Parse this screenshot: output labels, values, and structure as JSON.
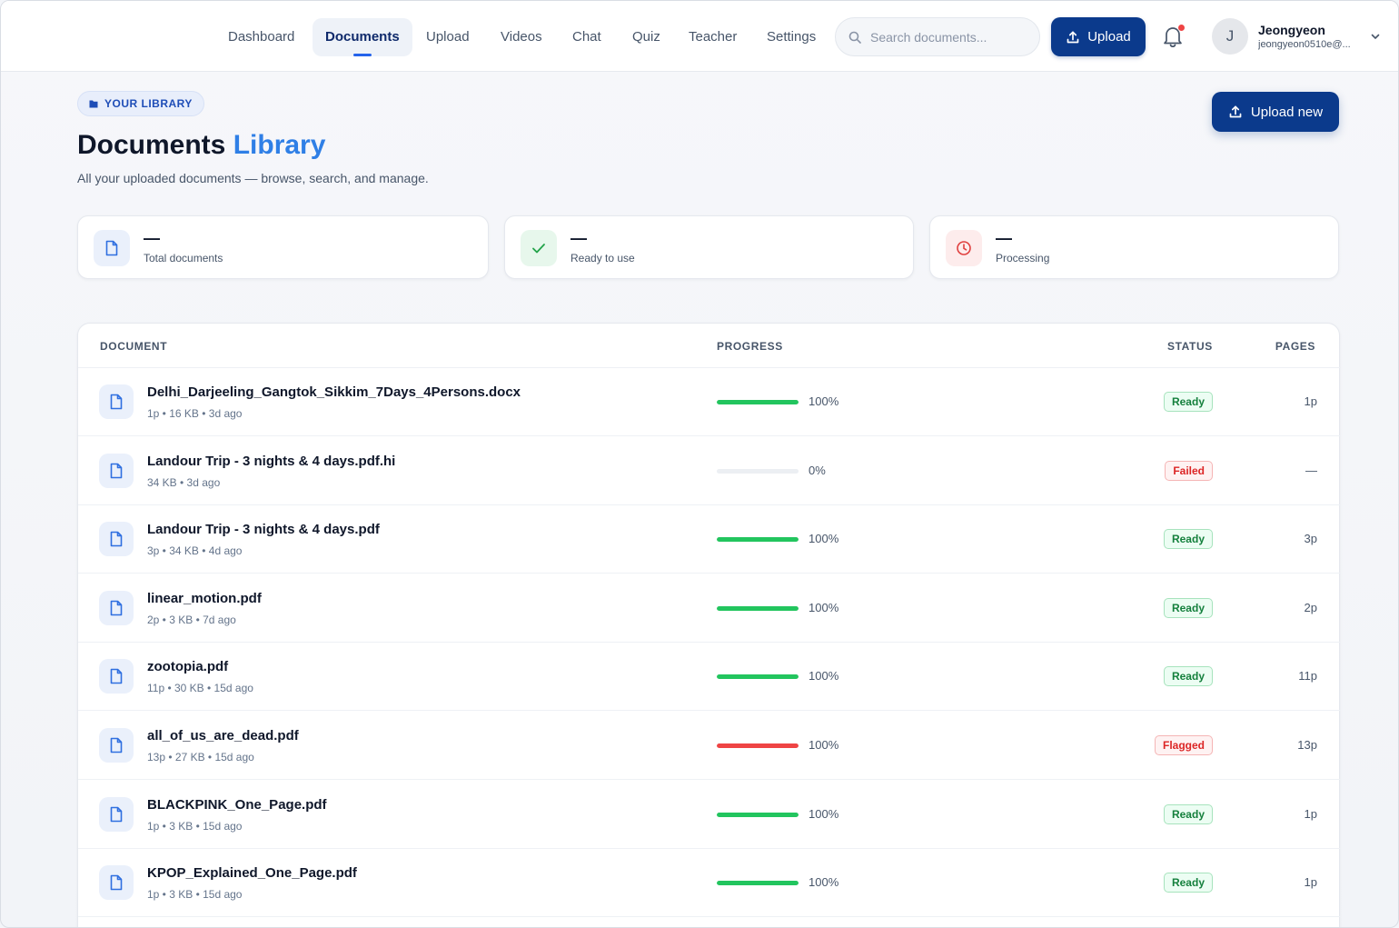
{
  "nav": {
    "items": [
      {
        "label": "Dashboard",
        "active": false
      },
      {
        "label": "Documents",
        "active": true
      },
      {
        "label": "Upload",
        "active": false
      },
      {
        "label": "Videos",
        "active": false
      },
      {
        "label": "Chat",
        "active": false
      },
      {
        "label": "Quiz",
        "active": false
      },
      {
        "label": "Teacher",
        "active": false
      },
      {
        "label": "Settings",
        "active": false
      }
    ],
    "search_placeholder": "Search documents...",
    "upload_label": "Upload",
    "user": {
      "initial": "J",
      "name": "Jeongyeon",
      "email": "jeongyeon0510e@..."
    }
  },
  "header": {
    "badge": "YOUR LIBRARY",
    "title_main": "Documents",
    "title_accent": "Library",
    "subtitle": "All your uploaded documents — browse, search, and manage.",
    "upload_new_label": "Upload new"
  },
  "stats": [
    {
      "value": "—",
      "label": "Total documents"
    },
    {
      "value": "—",
      "label": "Ready to use"
    },
    {
      "value": "—",
      "label": "Processing"
    }
  ],
  "table": {
    "headers": {
      "document": "DOCUMENT",
      "progress": "PROGRESS",
      "status": "STATUS",
      "pages": "PAGES"
    },
    "rows": [
      {
        "name": "Delhi_Darjeeling_Gangtok_Sikkim_7Days_4Persons.docx",
        "meta": "1p • 16 KB • 3d ago",
        "progress": 100,
        "progress_label": "100%",
        "status": "Ready",
        "pages": "1p"
      },
      {
        "name": "Landour Trip - 3 nights & 4 days.pdf.hi",
        "meta": "34 KB • 3d ago",
        "progress": 0,
        "progress_label": "0%",
        "status": "Failed",
        "pages": "—"
      },
      {
        "name": "Landour Trip - 3 nights & 4 days.pdf",
        "meta": "3p • 34 KB • 4d ago",
        "progress": 100,
        "progress_label": "100%",
        "status": "Ready",
        "pages": "3p"
      },
      {
        "name": "linear_motion.pdf",
        "meta": "2p • 3 KB • 7d ago",
        "progress": 100,
        "progress_label": "100%",
        "status": "Ready",
        "pages": "2p"
      },
      {
        "name": "zootopia.pdf",
        "meta": "11p • 30 KB • 15d ago",
        "progress": 100,
        "progress_label": "100%",
        "status": "Ready",
        "pages": "11p"
      },
      {
        "name": "all_of_us_are_dead.pdf",
        "meta": "13p • 27 KB • 15d ago",
        "progress": 100,
        "progress_label": "100%",
        "status": "Flagged",
        "pages": "13p"
      },
      {
        "name": "BLACKPINK_One_Page.pdf",
        "meta": "1p • 3 KB • 15d ago",
        "progress": 100,
        "progress_label": "100%",
        "status": "Ready",
        "pages": "1p"
      },
      {
        "name": "KPOP_Explained_One_Page.pdf",
        "meta": "1p • 3 KB • 15d ago",
        "progress": 100,
        "progress_label": "100%",
        "status": "Ready",
        "pages": "1p"
      }
    ]
  },
  "colors": {
    "brand": "#0b3a8c",
    "accent": "#2f7fe6",
    "ready": "#22c55e",
    "flagged": "#ef4444",
    "failed": "#dc2626"
  },
  "icons": {
    "search": "search-icon",
    "upload": "upload-icon",
    "bell": "bell-icon",
    "chevron": "chevron-down-icon",
    "document": "document-icon",
    "check": "check-icon",
    "clock": "clock-icon",
    "folder": "folder-icon"
  }
}
